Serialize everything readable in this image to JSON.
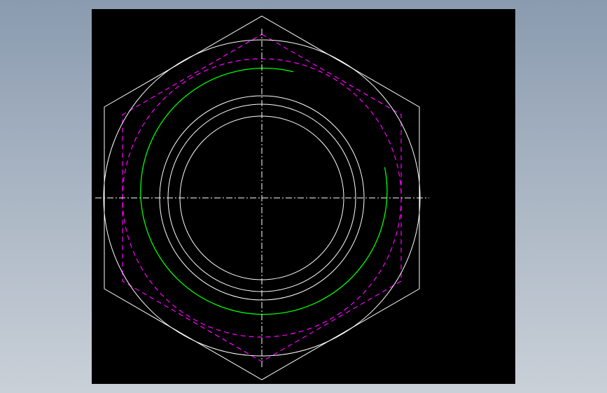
{
  "drawing": {
    "background_color": "#000000",
    "colors": {
      "outline": "#ffffff",
      "thread": "#00ff00",
      "hidden": "#ff00ff",
      "centerline": "#ffffff"
    },
    "line_styles": {
      "hidden": "dashed",
      "centerline": "dash-dot"
    }
  }
}
